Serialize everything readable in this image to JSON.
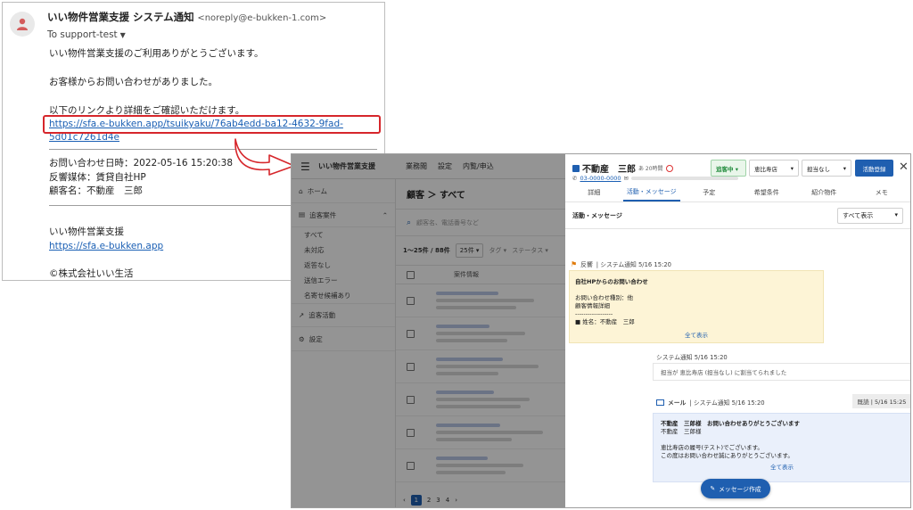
{
  "email": {
    "sender_name": "いい物件営業支援 システム通知",
    "sender_addr": "<noreply@e-bukken-1.com>",
    "to": "To support-test",
    "greeting": "いい物件営業支援のご利用ありがとうございます。",
    "inquiry": "お客様からお問い合わせがありました。",
    "link_intro": "以下のリンクより詳細をご確認いただけます。",
    "link": "https://sfa.e-bukken.app/tsuikyaku/76ab4edd-ba12-4632-9fad-5d01c7261d4e",
    "info_date": "お問い合わせ日時：2022-05-16 15:20:38",
    "info_media": "反響媒体：賃貸自社HP",
    "info_customer": "顧客名：不動産　三郎",
    "sig_name": "いい物件営業支援",
    "sig_link": "https://sfa.e-bukken.app",
    "copyright": "©株式会社いい生活"
  },
  "app": {
    "brand": "いい物件営業支援",
    "top_tabs": [
      "業務閲",
      "設定",
      "内覧/申込"
    ],
    "sidenav": {
      "home": "ホーム",
      "tracking": "追客案件",
      "sub": [
        "すべて",
        "未対応",
        "返答なし",
        "送信エラー",
        "名寄せ候補あり"
      ],
      "activity": "追客活動",
      "settings": "設定"
    },
    "list": {
      "title": "顧客 ＞ すべて",
      "search_placeholder": "顧客名、電話番号など",
      "count": "1〜25件 / 88件",
      "per_page": "25件 ▾",
      "tag": "タグ ▾",
      "status_filter": "ステータス ▾",
      "col_header": "案件情報",
      "pages": [
        "1",
        "2",
        "3",
        "4",
        "›"
      ]
    },
    "detail": {
      "name": "不動産　三郎",
      "age": "あ 20時間",
      "phone": "03-0000-0000",
      "status": "追客中 ▾",
      "shop": "恵比寿店",
      "staff": "担当なし",
      "activity_btn": "活動登録",
      "tabs": [
        "詳細",
        "活動・メッセージ",
        "予定",
        "希望条件",
        "紹介物件",
        "メモ"
      ],
      "section_title": "活動・メッセージ",
      "filter": "すべて表示",
      "feedback_meta_a": "反響",
      "feedback_meta_b": "| システム通知 5/16 15:20",
      "feedback_title": "自社HPからのお問い合わせ",
      "feedback_line1": "お問い合わせ種別：他",
      "feedback_line2": "顧客情報詳細",
      "feedback_line3": "------------------",
      "feedback_line4": "■ 姓名：不動産　三郎",
      "show_all": "全て表示",
      "sys_meta": "システム通知 5/16 15:20",
      "sys_msg": "担当が 恵比寿店 (担当なし) に割当てられました",
      "mail_meta_a": "メール",
      "mail_meta_b": "| システム通知 5/16 15:20",
      "read_badge": "既読 | 5/16 15:25",
      "mail_title": "不動産　三郎様　お問い合わせありがとうございます",
      "mail_line1": "不動産　三郎様",
      "mail_line2": "恵比寿店の履号(テスト)でございます。",
      "mail_line3": "この度はお問い合わせ誠にありがとうございます。",
      "mail_show_all": "全て表示",
      "fab": "メッセージ作成"
    }
  },
  "colors": {
    "accent": "#1f5fb0",
    "highlight": "#d6262b",
    "feedback_bg": "#fdf4d6",
    "mail_bg": "#eaf0fb"
  }
}
